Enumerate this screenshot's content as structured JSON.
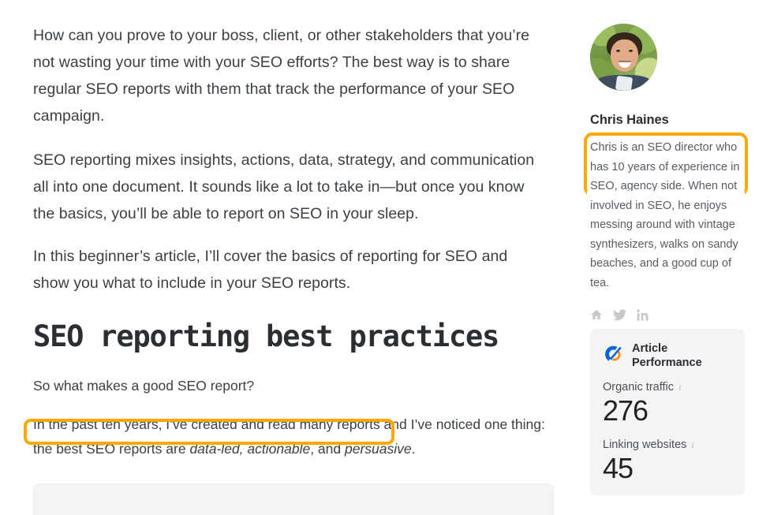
{
  "article": {
    "paragraphs": [
      "How can you prove to your boss, client, or other stakeholders that you’re not wasting your time with your SEO efforts? The best way is to share regular SEO reports with them that track the performance of your SEO campaign.",
      "SEO reporting mixes insights, actions, data, strategy, and communication all into one document. It sounds like a lot to take in—but once you know the basics, you’ll be able to report on SEO in your sleep.",
      "In this beginner’s article, I’ll cover the basics of reporting for SEO and show you what to include in your SEO reports."
    ],
    "heading": "SEO reporting best practices",
    "question": "So what makes a good SEO report?",
    "final_paragraph": {
      "highlighted": "In the past ten years, I’ve created and read many reports",
      "rest_before_italics": " and I’ve noticed one thing: the best SEO reports are ",
      "italic_1": "data-led, actionable",
      "conjunction": ", and ",
      "italic_2": "persuasive",
      "period": "."
    }
  },
  "sidebar": {
    "author": {
      "avatar_alt": "author-photo",
      "name": "Chris Haines",
      "bio_highlighted": "Chris is an SEO director who has 10 years of experience in SEO, agency side. When",
      "bio_rest": " not involved in SEO, he enjoys messing around with vintage synthesizers, walks on sandy beaches, and a good cup of tea.",
      "socials": [
        "home-icon",
        "twitter-icon",
        "linkedin-icon"
      ]
    },
    "performance_card": {
      "logo": "ahrefs-logo-icon",
      "title": "Article Performance",
      "metrics": [
        {
          "label": "Organic traffic",
          "info": "i",
          "value": "276"
        },
        {
          "label": "Linking websites",
          "info": "i",
          "value": "45"
        }
      ]
    }
  },
  "colors": {
    "highlight_orange": "#ffa800",
    "card_background": "#f4f4f5",
    "text_primary": "#3b4045",
    "logo_blue": "#0b64dd",
    "logo_orange": "#ff8a00"
  }
}
